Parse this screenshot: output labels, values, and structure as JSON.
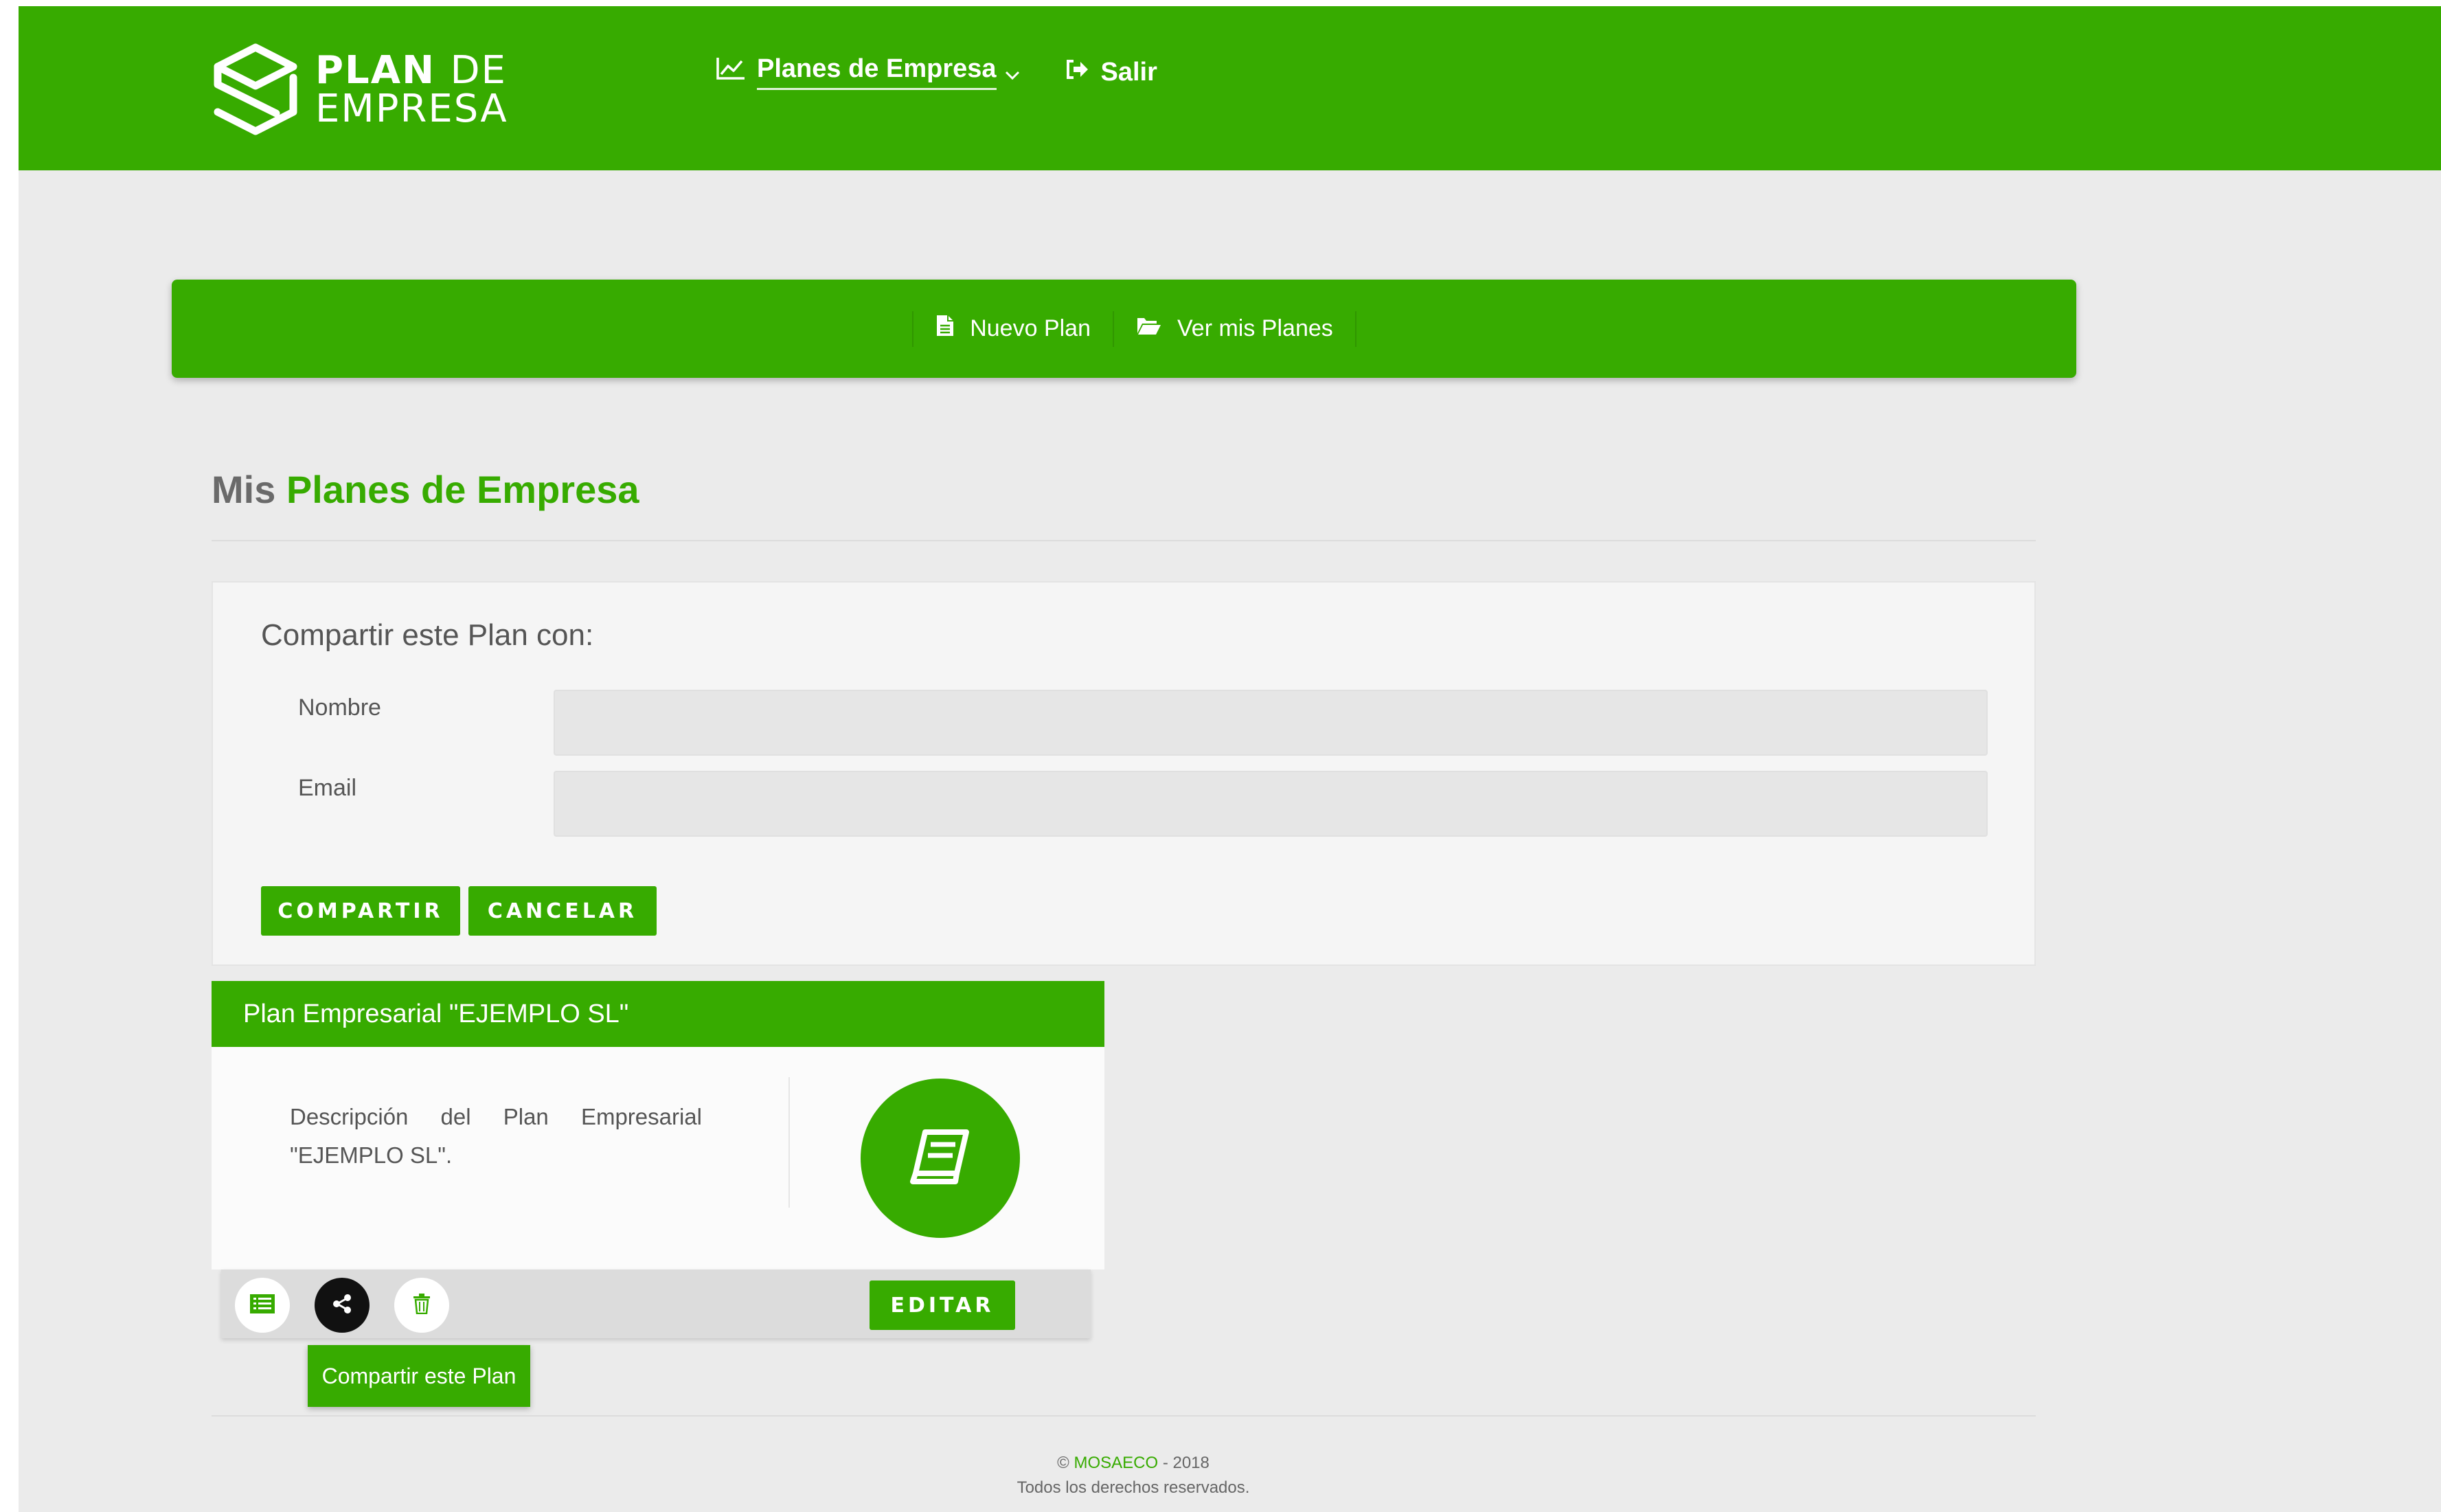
{
  "colors": {
    "brand_green": "#37ab00",
    "background": "#ebebeb",
    "panel": "#f5f5f5",
    "dark_button": "#111111"
  },
  "logo": {
    "line1_bold": "PLAN",
    "line1_thin": "DE",
    "line2": "EMPRESA",
    "icon": "box-logo-icon"
  },
  "navbar": {
    "items": [
      {
        "label": "Planes de Empresa",
        "icon": "chart-line-icon",
        "has_dropdown": true
      },
      {
        "label": "Salir",
        "icon": "sign-out-icon"
      }
    ]
  },
  "subbar": {
    "items": [
      {
        "label": "Nuevo Plan",
        "icon": "file-icon"
      },
      {
        "label": "Ver mis Planes",
        "icon": "folder-open-icon"
      }
    ]
  },
  "heading": {
    "prefix": "Mis",
    "accent": "Planes de Empresa"
  },
  "share_form": {
    "title": "Compartir este Plan con:",
    "fields": [
      {
        "label": "Nombre",
        "value": "",
        "placeholder": ""
      },
      {
        "label": "Email",
        "value": "",
        "placeholder": ""
      }
    ],
    "submit_label": "COMPARTIR",
    "cancel_label": "CANCELAR"
  },
  "plan_card": {
    "title": "Plan Empresarial \"EJEMPLO SL\"",
    "description": "Descripción del Plan Empresarial \"EJEMPLO SL\".",
    "icon": "book-icon",
    "actions": [
      {
        "name": "list-icon",
        "style": "light"
      },
      {
        "name": "share-icon",
        "style": "dark"
      },
      {
        "name": "trash-icon",
        "style": "light"
      }
    ],
    "edit_label": "EDITAR",
    "tooltip": "Compartir este Plan"
  },
  "footer": {
    "copyright_symbol": "©",
    "brand": "MOSAECO",
    "year_text": "- 2018",
    "rights": "Todos los derechos reservados."
  }
}
